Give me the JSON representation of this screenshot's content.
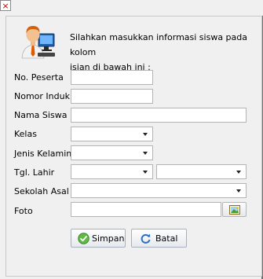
{
  "window": {
    "close_glyph": "×"
  },
  "intro": {
    "icon": "user-computer-icon",
    "line1": "Silahkan masukkan informasi siswa pada kolom",
    "line2": "isian di bawah ini :"
  },
  "form": {
    "no_peserta": {
      "label": "No. Peserta",
      "value": ""
    },
    "nomor_induk": {
      "label": "Nomor Induk",
      "value": ""
    },
    "nama_siswa": {
      "label": "Nama Siswa",
      "value": ""
    },
    "kelas": {
      "label": "Kelas",
      "selected": ""
    },
    "jenis_kelamin": {
      "label": "Jenis Kelamin",
      "selected": ""
    },
    "tgl_lahir": {
      "label": "Tgl. Lahir",
      "selected_1": "",
      "selected_2": ""
    },
    "sekolah_asal": {
      "label": "Sekolah Asal",
      "selected": ""
    },
    "foto": {
      "label": "Foto",
      "value": "",
      "browse_icon": "image-icon"
    }
  },
  "buttons": {
    "simpan": {
      "label": "Simpan",
      "icon": "check-circle-icon"
    },
    "batal": {
      "label": "Batal",
      "icon": "refresh-icon"
    }
  }
}
